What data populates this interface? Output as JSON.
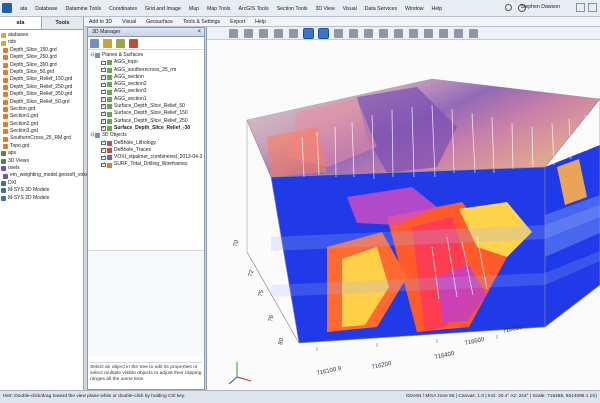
{
  "menubar": {
    "items": [
      "ata",
      "Database",
      "Datamine Tools",
      "Coordinates",
      "Grid and Image",
      "Map",
      "Map Tools",
      "ArcGIS Tools",
      "Section Tools",
      "3D View",
      "Visual",
      "Data Services",
      "Window",
      "Help"
    ],
    "user": "Stephen Dawson"
  },
  "left_panel": {
    "tabs": [
      "ata",
      "Tools"
    ],
    "items": [
      {
        "label": "atabases",
        "level": 1,
        "color": "#d9a63a"
      },
      {
        "label": "rids",
        "level": 1,
        "color": "#d9a63a"
      },
      {
        "label": "Depth_Slice_150.grd",
        "level": 2,
        "color": "#e07b2a"
      },
      {
        "label": "Depth_Slice_250.grd",
        "level": 2,
        "color": "#e07b2a"
      },
      {
        "label": "Depth_Slice_350.grd",
        "level": 2,
        "color": "#e07b2a"
      },
      {
        "label": "Depth_Slice_50.grd",
        "level": 2,
        "color": "#e07b2a"
      },
      {
        "label": "Depth_Slice_Relief_150.grd",
        "level": 2,
        "color": "#e07b2a"
      },
      {
        "label": "Depth_Slice_Relief_250.grd",
        "level": 2,
        "color": "#e07b2a"
      },
      {
        "label": "Depth_Slice_Relief_350.grd",
        "level": 2,
        "color": "#e07b2a"
      },
      {
        "label": "Depth_Slice_Relief_50.grd",
        "level": 2,
        "color": "#e07b2a"
      },
      {
        "label": "Section.grd",
        "level": 2,
        "color": "#e07b2a"
      },
      {
        "label": "Section1.grd",
        "level": 2,
        "color": "#e07b2a"
      },
      {
        "label": "Section2.grd",
        "level": 2,
        "color": "#e07b2a"
      },
      {
        "label": "Section3.grd",
        "level": 2,
        "color": "#e07b2a"
      },
      {
        "label": "SouthernCross_25_RM.grd",
        "level": 2,
        "color": "#e07b2a"
      },
      {
        "label": "Topo.grd",
        "level": 2,
        "color": "#e07b2a"
      },
      {
        "label": "aps",
        "level": 1,
        "color": "#4b8a3a"
      },
      {
        "label": "3D Views",
        "level": 1,
        "color": "#4b8a3a"
      },
      {
        "label": "oxels",
        "level": 1,
        "color": "#7b4db0"
      },
      {
        "label": "em_weighting_model.geosoft_voxel",
        "level": 2,
        "color": "#7b4db0"
      },
      {
        "label": "DXI",
        "level": 1,
        "color": "#3a6fb0"
      },
      {
        "label": "M-SYS 3D Models",
        "level": 1,
        "color": "#3a6fb0"
      },
      {
        "label": "M-SYS 2D Models",
        "level": 1,
        "color": "#3a6fb0"
      }
    ]
  },
  "ribbon": {
    "items": [
      "Add to 3D",
      "Visual",
      "Geosurface",
      "Tools & Settings",
      "Export",
      "Help"
    ]
  },
  "manager": {
    "title": "3D Manager",
    "items": [
      {
        "label": "Planes & Surfaces",
        "checked": null,
        "level": 0,
        "color": "#7a8fb8",
        "bold": false
      },
      {
        "label": "AGG_topo",
        "checked": false,
        "level": 1,
        "color": "#6aa84f",
        "bold": false
      },
      {
        "label": "AGG_southerncross_25_rm",
        "checked": true,
        "level": 1,
        "color": "#6aa84f",
        "bold": false
      },
      {
        "label": "AGG_section",
        "checked": true,
        "level": 1,
        "color": "#6aa84f",
        "bold": false
      },
      {
        "label": "AGG_section2",
        "checked": true,
        "level": 1,
        "color": "#6aa84f",
        "bold": false
      },
      {
        "label": "AGG_section3",
        "checked": true,
        "level": 1,
        "color": "#6aa84f",
        "bold": false
      },
      {
        "label": "AGG_section1",
        "checked": true,
        "level": 1,
        "color": "#6aa84f",
        "bold": false
      },
      {
        "label": "Surface_Depth_Slice_Relief_50",
        "checked": true,
        "level": 1,
        "color": "#6aa84f",
        "bold": false
      },
      {
        "label": "Surface_Depth_Slice_Relief_150",
        "checked": true,
        "level": 1,
        "color": "#6aa84f",
        "bold": false
      },
      {
        "label": "Surface_Depth_Slice_Relief_250",
        "checked": true,
        "level": 1,
        "color": "#6aa84f",
        "bold": false
      },
      {
        "label": "Surface_Depth_Slice_Relief_-30",
        "checked": true,
        "level": 1,
        "color": "#6aa84f",
        "bold": true
      },
      {
        "label": "3D Objects",
        "checked": null,
        "level": 0,
        "color": "#7a8fb8",
        "bold": false
      },
      {
        "label": "DeBhole_Lithology",
        "checked": true,
        "level": 1,
        "color": "#c0504d",
        "bold": false
      },
      {
        "label": "DeBhole_Traces",
        "checked": true,
        "level": 1,
        "color": "#c0504d",
        "bold": false
      },
      {
        "label": "VOXI_vtpalmer_combinered_2013-04-2",
        "checked": true,
        "level": 1,
        "color": "#8064a2",
        "bold": false
      },
      {
        "label": "SURF_Total_Drilling_Wireframes",
        "checked": true,
        "level": 1,
        "color": "#e07b2a",
        "bold": false
      }
    ],
    "hint": "Select an object in the tree to edit its properties or select multiple visible objects to adjust their clipping ranges all the same time."
  },
  "view": {
    "x_ticks": [
      "716100.9",
      "716200",
      "716400",
      "716600",
      "716800"
    ],
    "y_ticks": [
      "6575",
      "6572",
      "6576",
      "6580",
      "6585",
      "6570",
      "6586",
      "6591"
    ],
    "z_ticks": [
      "70",
      "72",
      "75",
      "76",
      "80"
    ]
  },
  "status": {
    "left": "Hint: Double-click/drag toward the view plane while or double-click by holding Ctrl key.",
    "right": "GDA94 / MGA zone 55  |  Canvas: 1.0  |  Incl: 30.4° Az: 224° | Scale: 715465, 6514095.1 (m)"
  }
}
